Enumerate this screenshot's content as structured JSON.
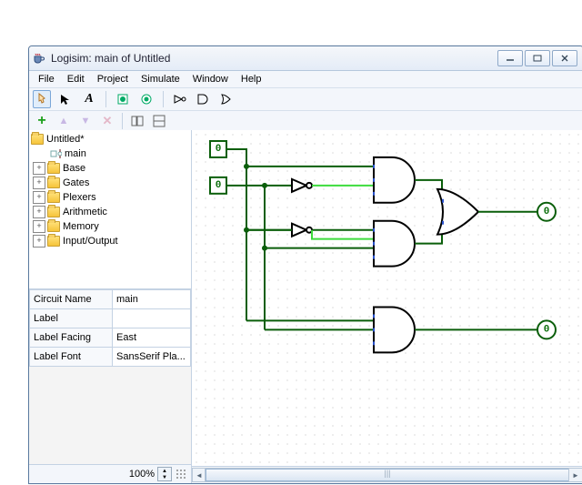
{
  "window": {
    "title": "Logisim: main of Untitled"
  },
  "menu": {
    "file": "File",
    "edit": "Edit",
    "project": "Project",
    "simulate": "Simulate",
    "window": "Window",
    "help": "Help"
  },
  "tree": {
    "root": "Untitled*",
    "main": "main",
    "base": "Base",
    "gates": "Gates",
    "plexers": "Plexers",
    "arithmetic": "Arithmetic",
    "memory": "Memory",
    "io": "Input/Output"
  },
  "props": {
    "k0": "Circuit Name",
    "v0": "main",
    "k1": "Label",
    "v1": "",
    "k2": "Label Facing",
    "v2": "East",
    "k3": "Label Font",
    "v3": "SansSerif Pla..."
  },
  "zoom": {
    "level": "100%"
  },
  "pins": {
    "inA": "0",
    "inB": "0",
    "out1": "0",
    "out2": "0"
  }
}
